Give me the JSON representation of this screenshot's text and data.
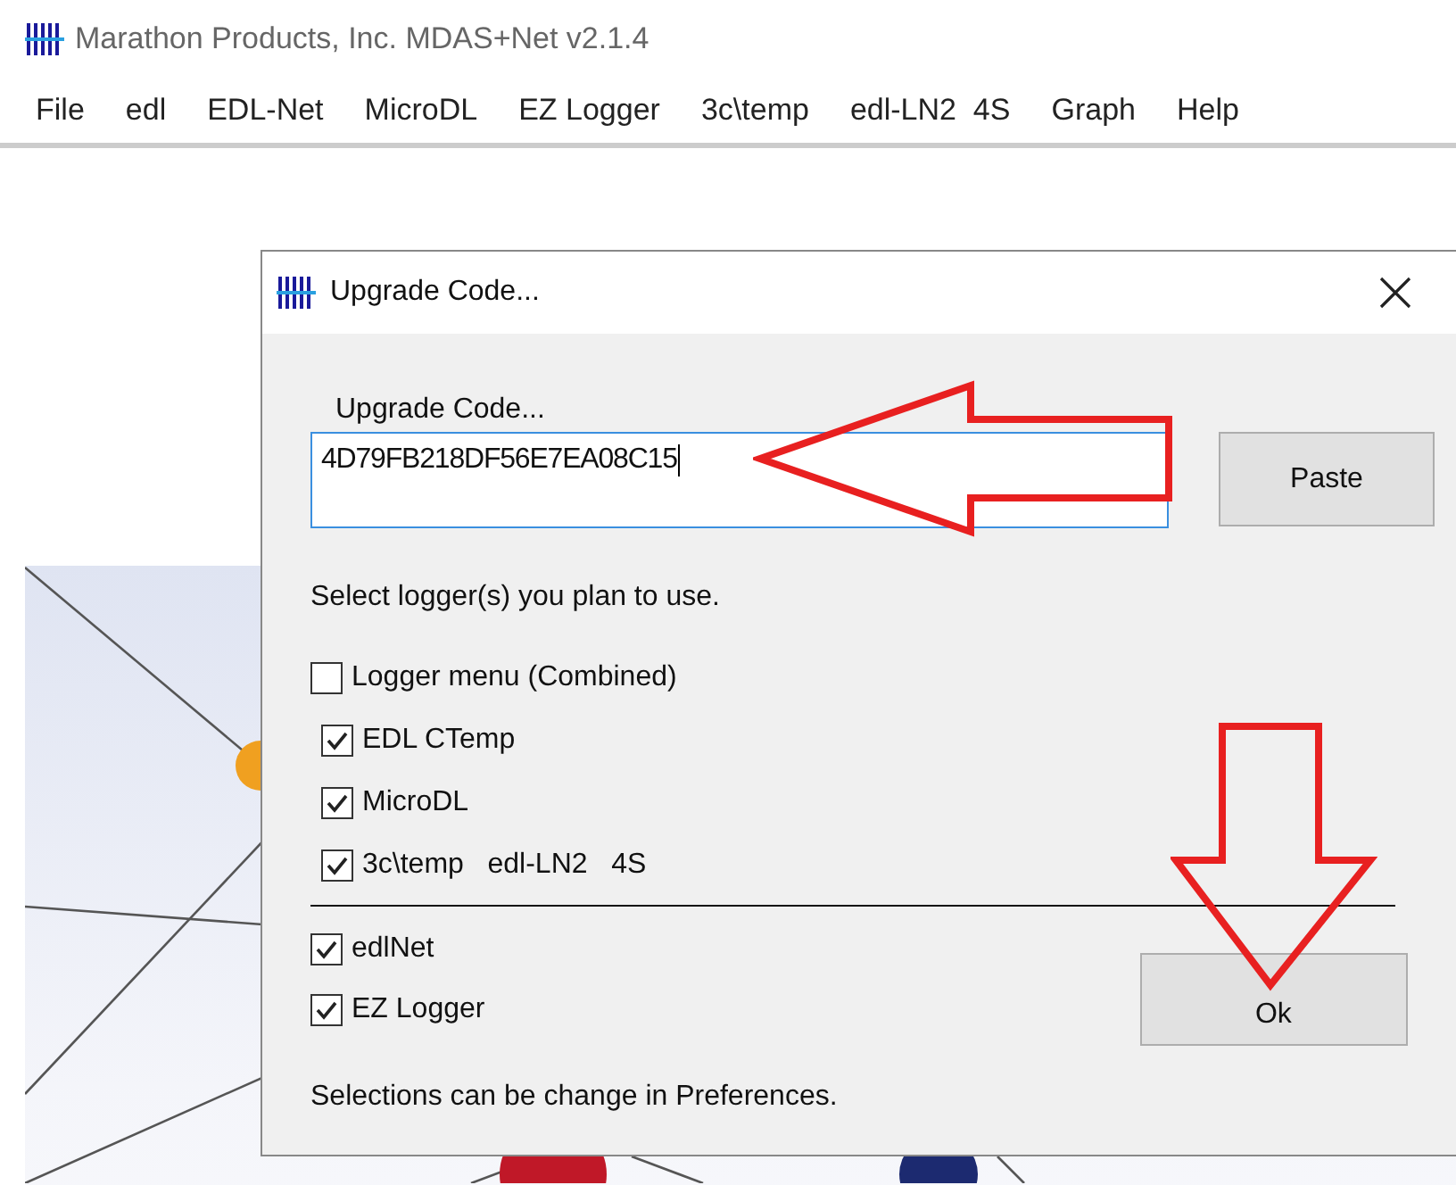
{
  "window": {
    "title": "Marathon Products, Inc.  MDAS+Net  v2.1.4"
  },
  "menu": [
    "File",
    "edl",
    "EDL-Net",
    "MicroDL",
    "EZ Logger",
    "3c\\temp",
    "edl-LN2  4S",
    "Graph",
    "Help"
  ],
  "dialog": {
    "title": "Upgrade Code...",
    "code_label": "Upgrade Code...",
    "code_value": "4D79FB218DF56E7EA08C15",
    "paste_button": "Paste",
    "instruction": "Select logger(s) you plan to use.",
    "loggers": [
      {
        "label": "Logger menu (Combined)",
        "checked": false
      },
      {
        "label": "EDL CTemp",
        "checked": true
      },
      {
        "label": "MicroDL",
        "checked": true
      },
      {
        "label": "3c\\temp   edl-LN2   4S",
        "checked": true
      }
    ],
    "extras": [
      {
        "label": "edlNet",
        "checked": true
      },
      {
        "label": "EZ Logger",
        "checked": true
      }
    ],
    "ok_button": "Ok",
    "footer": "Selections can be change in Preferences."
  }
}
